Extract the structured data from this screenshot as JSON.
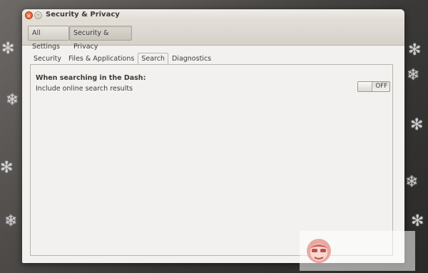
{
  "window": {
    "title": "Security & Privacy",
    "close_glyph": "×",
    "minimize_glyph": "–"
  },
  "toolbar": {
    "breadcrumbs": [
      {
        "label": "All Settings"
      },
      {
        "label": "Security & Privacy"
      }
    ]
  },
  "tabs": [
    {
      "label": "Security"
    },
    {
      "label": "Files & Applications"
    },
    {
      "label": "Search",
      "active": true
    },
    {
      "label": "Diagnostics"
    }
  ],
  "search_tab": {
    "heading": "When searching in the Dash:",
    "option_label": "Include online search results",
    "toggle_state": "OFF"
  },
  "colors": {
    "close_button": "#df4a16",
    "window_bg": "#f2f1f0",
    "text": "#3c3b37"
  },
  "icons": [
    "close-icon",
    "minimize-icon",
    "watermark-monkey-logo"
  ]
}
